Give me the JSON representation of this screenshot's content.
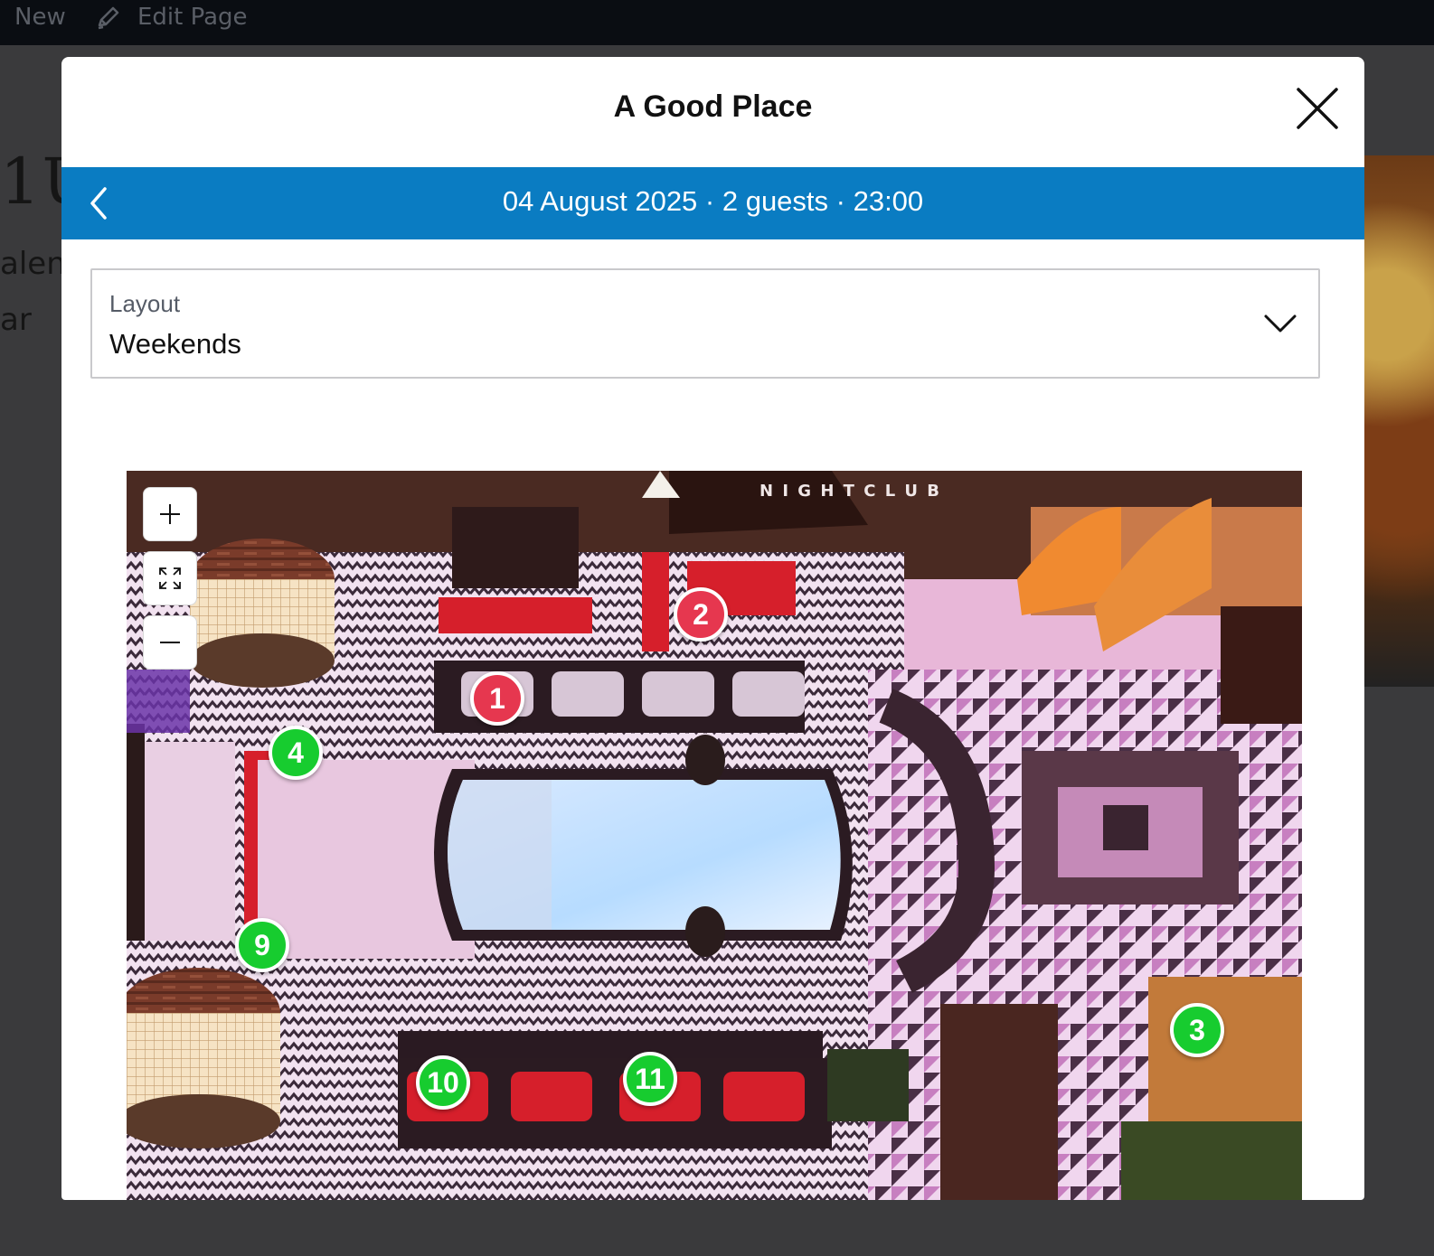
{
  "admin_bar": {
    "new_label": "New",
    "edit_label": "Edit Page",
    "edit_icon": "pencil-icon"
  },
  "background": {
    "heading_fragment": "1U",
    "text_line_1": "alent",
    "text_line_2": "ar"
  },
  "modal": {
    "title": "A Good Place",
    "close_icon": "close-icon",
    "booking": {
      "back_icon": "chevron-left-icon",
      "summary": "04 August 2025 · 2 guests · 23:00"
    },
    "layout_select": {
      "label": "Layout",
      "value": "Weekends",
      "icon": "chevron-down-icon"
    },
    "map": {
      "sign_text": "N I G H T C L U B",
      "controls": {
        "zoom_in_icon": "plus-icon",
        "fit_icon": "expand-icon",
        "zoom_out_icon": "minus-icon"
      },
      "status_colors": {
        "unavailable": "#e6374f",
        "available": "#17cc2f"
      },
      "tables": [
        {
          "number": "1",
          "status": "unavailable"
        },
        {
          "number": "2",
          "status": "unavailable"
        },
        {
          "number": "3",
          "status": "available"
        },
        {
          "number": "4",
          "status": "available"
        },
        {
          "number": "9",
          "status": "available"
        },
        {
          "number": "10",
          "status": "available"
        },
        {
          "number": "11",
          "status": "available"
        }
      ]
    }
  },
  "colors": {
    "accent_bar": "#0a7cc2",
    "admin_bar": "#0a0d12",
    "backdrop": "#3a3a3c"
  }
}
